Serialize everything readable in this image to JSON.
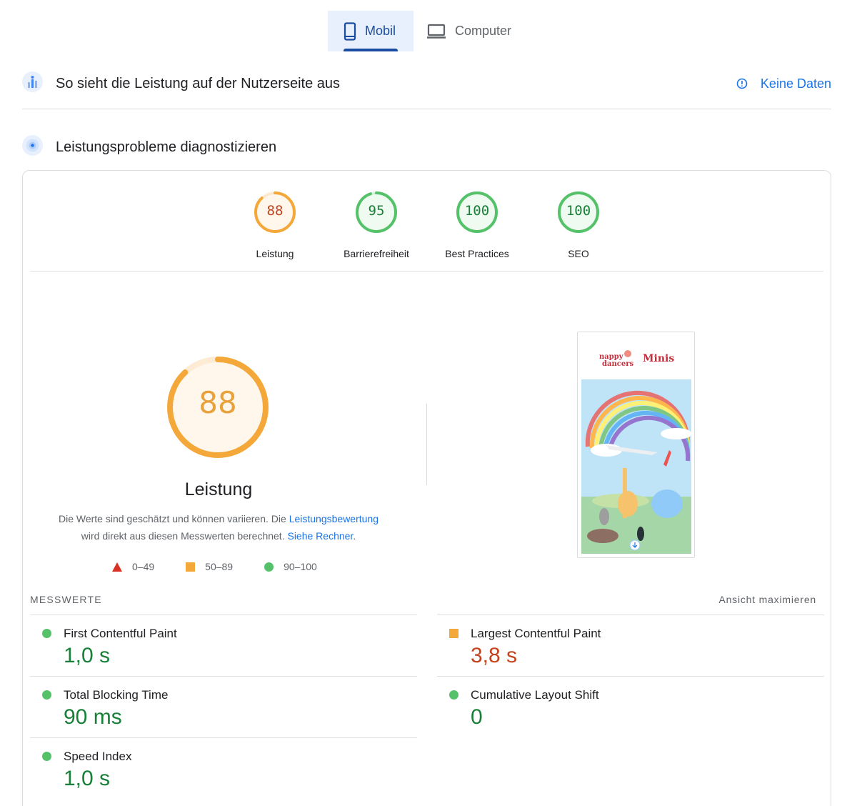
{
  "tabs": [
    {
      "label": "Mobil",
      "icon": "phone-icon",
      "active": true
    },
    {
      "label": "Computer",
      "icon": "laptop-icon",
      "active": false
    }
  ],
  "field_section": {
    "title": "So sieht die Leistung auf der Nutzerseite aus",
    "no_data_label": "Keine Daten"
  },
  "diagnose_section": {
    "title": "Leistungsprobleme diagnostizieren"
  },
  "scores": [
    {
      "value": "88",
      "label": "Leistung",
      "fraction": 0.88,
      "color": "#f4a83a",
      "text_color": "#c5421d"
    },
    {
      "value": "95",
      "label": "Barrierefreiheit",
      "fraction": 0.95,
      "color": "#55c26a",
      "text_color": "#188038"
    },
    {
      "value": "100",
      "label": "Best Practices",
      "fraction": 1.0,
      "color": "#55c26a",
      "text_color": "#188038"
    },
    {
      "value": "100",
      "label": "SEO",
      "fraction": 1.0,
      "color": "#55c26a",
      "text_color": "#188038"
    }
  ],
  "performance": {
    "score": "88",
    "fraction": 0.88,
    "label": "Leistung",
    "desc_part1": "Die Werte sind geschätzt und können variieren. Die ",
    "desc_link1": "Leistungsbewertung",
    "desc_part2": " wird direkt aus diesen Messwerten berechnet. ",
    "desc_link2": "Siehe Rechner",
    "desc_part3": "."
  },
  "legend": {
    "poor": "0–49",
    "average": "50–89",
    "good": "90–100"
  },
  "screenshot": {
    "brand_line1": "nappy",
    "brand_line2": "dancers",
    "brand_suffix": "Minis"
  },
  "metrics": {
    "header": "MESSWERTE",
    "expand_label": "Ansicht maximieren",
    "left": [
      {
        "name": "First Contentful Paint",
        "value": "1,0 s",
        "status": "good"
      },
      {
        "name": "Total Blocking Time",
        "value": "90 ms",
        "status": "good"
      },
      {
        "name": "Speed Index",
        "value": "1,0 s",
        "status": "good"
      }
    ],
    "right": [
      {
        "name": "Largest Contentful Paint",
        "value": "3,8 s",
        "status": "average"
      },
      {
        "name": "Cumulative Layout Shift",
        "value": "0",
        "status": "good"
      }
    ]
  },
  "colors": {
    "accent": "#1a73e8",
    "tab_active": "#1a4ca3",
    "good": "#188038",
    "average": "#c5421d",
    "gauge_average": "#f4a83a",
    "gauge_good": "#55c26a"
  }
}
